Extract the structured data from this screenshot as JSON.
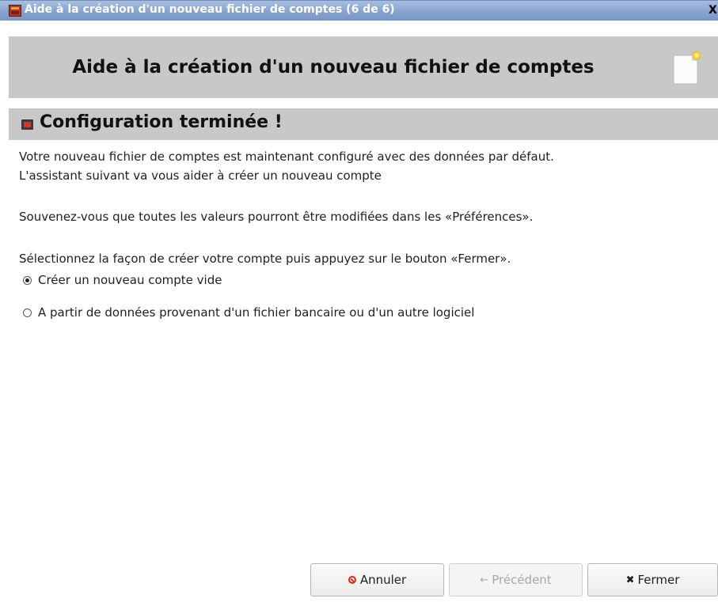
{
  "window": {
    "title": "Aide à la création d'un nouveau fichier de comptes (6 de 6)",
    "close_label": "X"
  },
  "header": {
    "title": "Aide à la création d'un nouveau fichier de comptes"
  },
  "section": {
    "title": "Configuration terminée !"
  },
  "body": {
    "line1": "Votre nouveau fichier de comptes est maintenant configuré avec des données par défaut.",
    "line2": "L'assistant suivant va vous aider à créer un nouveau compte",
    "line3": "Souvenez-vous que toutes les valeurs pourront être modifiées dans les «Préférences».",
    "line4": "Sélectionnez la façon de créer votre compte puis appuyez sur le bouton «Fermer»."
  },
  "options": [
    {
      "label": "Créer un nouveau compte vide",
      "checked": true
    },
    {
      "label": "A partir de données provenant d'un fichier bancaire ou d'un autre logiciel",
      "checked": false
    }
  ],
  "buttons": {
    "cancel": "Annuler",
    "previous": "Précédent",
    "close": "Fermer"
  },
  "icons": {
    "app": "wallet-icon",
    "header": "new-document-icon",
    "section": "section-marker-icon",
    "cancel": "cancel-icon",
    "previous": "arrow-left-icon",
    "close": "x-icon"
  },
  "colors": {
    "titlebar": "#86a2cf",
    "header_bg": "#c8c8c8",
    "cancel_accent": "#d22a1e"
  }
}
